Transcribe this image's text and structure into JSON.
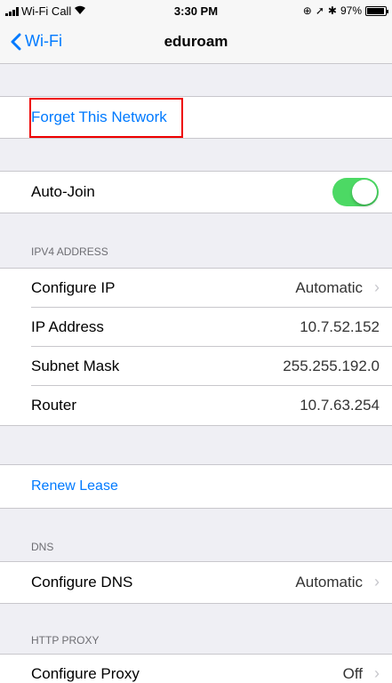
{
  "status_bar": {
    "carrier": "Wi-Fi Call",
    "time": "3:30 PM",
    "battery": "97%",
    "battery_level": 0.97,
    "icons": [
      "signal-icon",
      "wifi-icon",
      "alarm-icon",
      "location-icon",
      "bluetooth-icon",
      "battery-icon"
    ]
  },
  "nav": {
    "back_label": "Wi-Fi",
    "title": "eduroam"
  },
  "actions": {
    "forget": "Forget This Network",
    "renew": "Renew Lease"
  },
  "auto_join": {
    "label": "Auto-Join",
    "on": true
  },
  "ipv4": {
    "header": "IPV4 ADDRESS",
    "rows": [
      {
        "label": "Configure IP",
        "value": "Automatic"
      },
      {
        "label": "IP Address",
        "value": "10.7.52.152"
      },
      {
        "label": "Subnet Mask",
        "value": "255.255.192.0"
      },
      {
        "label": "Router",
        "value": "10.7.63.254"
      }
    ]
  },
  "dns": {
    "header": "DNS",
    "configure_label": "Configure DNS",
    "configure_value": "Automatic"
  },
  "proxy": {
    "header": "HTTP PROXY",
    "configure_label": "Configure Proxy",
    "configure_value": "Off"
  },
  "colors": {
    "accent": "#007aff",
    "toggle_on": "#4cd964",
    "highlight": "#e00000",
    "background": "#efeff4"
  }
}
